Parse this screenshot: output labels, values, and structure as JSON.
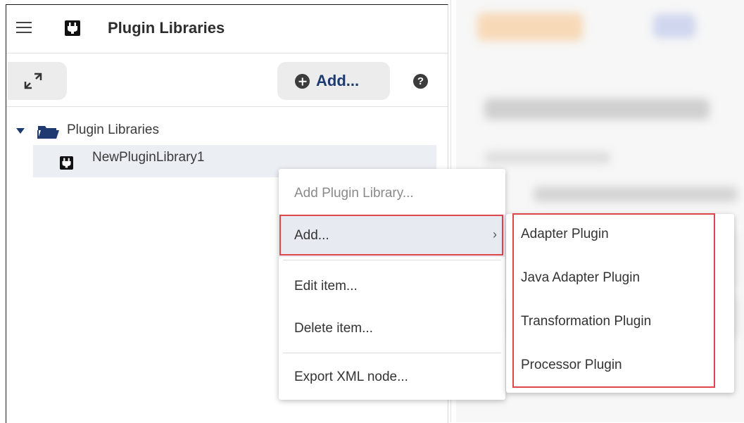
{
  "header": {
    "title": "Plugin Libraries",
    "menu_icon": "hamburger-menu-icon",
    "app_icon": "plug-icon"
  },
  "toolbar": {
    "add_label": "Add...",
    "expand_icon": "expand-arrows-icon",
    "help_label": "?"
  },
  "tree": {
    "root_label": "Plugin Libraries",
    "child_label": "NewPluginLibrary1"
  },
  "context_menu": {
    "items": [
      {
        "label": "Add Plugin Library...",
        "disabled": true
      },
      {
        "label": "Add...",
        "has_submenu": true,
        "chevron": "›"
      },
      {
        "label": "Edit item..."
      },
      {
        "label": "Delete item..."
      },
      {
        "label": "Export XML node..."
      }
    ]
  },
  "submenu": {
    "items": [
      {
        "label": "Adapter Plugin"
      },
      {
        "label": "Java Adapter Plugin"
      },
      {
        "label": "Transformation Plugin"
      },
      {
        "label": "Processor Plugin"
      }
    ]
  },
  "colors": {
    "accent": "#1e3a70",
    "highlight": "#e0454a",
    "selected_row": "#ebeef3"
  }
}
